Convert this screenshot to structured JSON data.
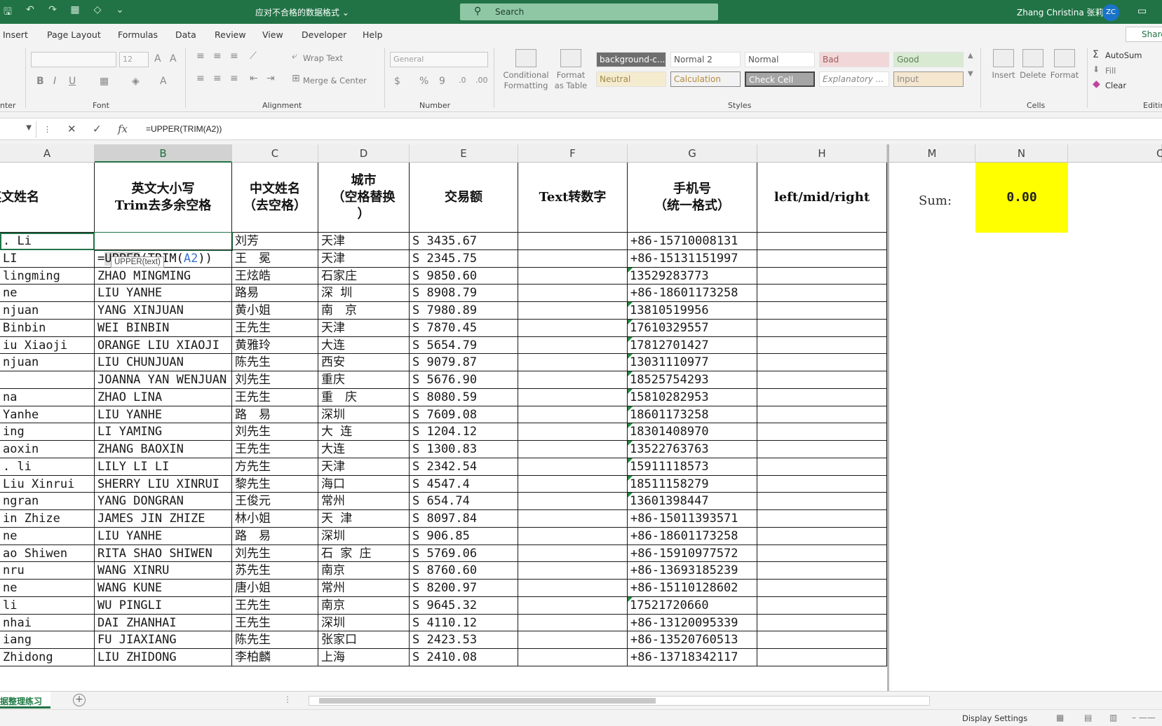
{
  "title_bar": {
    "doc_title": "应对不合格的数据格式",
    "search_placeholder": "Search",
    "user_name": "Zhang Christina 张莉",
    "avatar_initials": "ZC"
  },
  "menu_tabs": [
    "Insert",
    "Page Layout",
    "Formulas",
    "Data",
    "Review",
    "View",
    "Developer",
    "Help"
  ],
  "share_label": "Share",
  "ribbon": {
    "font_size": "12",
    "wrap_text": "Wrap Text",
    "merge_center": "Merge & Center",
    "number_format": "General",
    "conditional_formatting": "Conditional Formatting",
    "format_as_table": "Format as Table",
    "styles": [
      "background-c...",
      "Normal 2",
      "Normal",
      "Bad",
      "Good",
      "Neutral",
      "Calculation",
      "Check Cell",
      "Explanatory ...",
      "Input"
    ],
    "insert": "Insert",
    "delete": "Delete",
    "format": "Format",
    "autosum": "AutoSum",
    "fill": "Fill",
    "clear": "Clear",
    "groups": {
      "font": "Font",
      "alignment": "Alignment",
      "number": "Number",
      "styles": "Styles",
      "cells": "Cells",
      "editing": "Editin",
      "clipboard": "nter"
    }
  },
  "formula_bar": {
    "formula": "=UPPER(TRIM(A2))"
  },
  "columns": [
    "A",
    "B",
    "C",
    "D",
    "E",
    "F",
    "G",
    "H",
    "M",
    "N",
    "O"
  ],
  "header_row": {
    "A": "英文姓名",
    "B": "英文大小写\nTrim去多余空格",
    "C": "中文姓名\n（去空格）",
    "D": "城市\n（空格替换\n）",
    "E": "交易额",
    "F": "Text转数字",
    "G": "手机号\n（统一格式）",
    "H": "left/mid/right",
    "M": "Sum:",
    "N": "0.00"
  },
  "edit_cell": {
    "prefix": "=",
    "fn_highlight": "UPPER",
    "mid": "(TRIM(",
    "ref": "A2",
    "suffix": "))",
    "tooltip": "UPPER(text)"
  },
  "rows": [
    {
      "a": ". Li",
      "b": "",
      "c": "刘芳",
      "d": "天津",
      "e": "S 3435.67",
      "g": "+86-15710008131",
      "tri": false
    },
    {
      "a": "LI",
      "b": "",
      "c": "王　冕",
      "d": "天津",
      "e": "S 2345.75",
      "g": "+86-15131151997",
      "tri": false
    },
    {
      "a": "lingming",
      "b": "ZHAO MINGMING",
      "c": "王炫皓",
      "d": "石家庄",
      "e": "S 9850.60",
      "g": "13529283773",
      "tri": true
    },
    {
      "a": "ne",
      "b": "LIU YANHE",
      "c": "路易",
      "d": "深 圳",
      "e": "S 8908.79",
      "g": "+86-18601173258",
      "tri": false
    },
    {
      "a": "njuan",
      "b": "YANG XINJUAN",
      "c": "黄小姐",
      "d": "南　京",
      "e": "S 7980.89",
      "g": "13810519956",
      "tri": true
    },
    {
      "a": "  Binbin",
      "b": "WEI BINBIN",
      "c": "王先生",
      "d": "天津",
      "e": "S 7870.45",
      "g": "17610329557",
      "tri": true
    },
    {
      "a": "iu Xiaoji",
      "b": "ORANGE LIU XIAOJI",
      "c": "黄雅玲",
      "d": "大连",
      "e": "S 5654.79",
      "g": "17812701427",
      "tri": true
    },
    {
      "a": "njuan",
      "b": "LIU CHUNJUAN",
      "c": "陈先生",
      "d": "西安",
      "e": "S 9079.87",
      "g": "13031110977",
      "tri": true
    },
    {
      "a": "",
      "b": "JOANNA YAN WENJUAN",
      "c": "刘先生",
      "d": "重庆",
      "e": "S 5676.90",
      "g": "18525754293",
      "tri": true
    },
    {
      "a": "na",
      "b": "ZHAO LINA",
      "c": "王先生",
      "d": "重　庆",
      "e": "S 8080.59",
      "g": "15810282953",
      "tri": true
    },
    {
      "a": "Yanhe",
      "b": "LIU YANHE",
      "c": "路　易",
      "d": "深圳",
      "e": "S 7609.08",
      "g": "18601173258",
      "tri": true
    },
    {
      "a": "ing",
      "b": "LI YAMING",
      "c": "刘先生",
      "d": "大 连",
      "e": "S 1204.12",
      "g": "18301408970",
      "tri": true
    },
    {
      "a": "aoxin",
      "b": "ZHANG BAOXIN",
      "c": "王先生",
      "d": "大连",
      "e": "S 1300.83",
      "g": "13522763763",
      "tri": true
    },
    {
      "a": ". li",
      "b": "LILY LI LI",
      "c": "方先生",
      "d": "天津",
      "e": "S 2342.54",
      "g": "15911118573",
      "tri": true
    },
    {
      "a": "  Liu Xinrui",
      "b": "SHERRY LIU XINRUI",
      "c": "黎先生",
      "d": "海口",
      "e": "S 4547.4",
      "g": "18511158279",
      "tri": true
    },
    {
      "a": "ngran",
      "b": "YANG DONGRAN",
      "c": "王俊元",
      "d": "常州",
      "e": "S 654.74",
      "g": "13601398447",
      "tri": true
    },
    {
      "a": "in    Zhize",
      "b": "JAMES JIN ZHIZE",
      "c": "林小姐",
      "d": "天 津",
      "e": "S 8097.84",
      "g": "+86-15011393571",
      "tri": false
    },
    {
      "a": "ne",
      "b": "LIU YANHE",
      "c": "路　易",
      "d": "深圳",
      "e": "S 906.85",
      "g": "+86-18601173258",
      "tri": false
    },
    {
      "a": "ao  Shiwen",
      "b": "RITA SHAO SHIWEN",
      "c": "刘先生",
      "d": "石 家 庄",
      "e": "S 5769.06",
      "g": "+86-15910977572",
      "tri": false
    },
    {
      "a": "nru",
      "b": "WANG XINRU",
      "c": "苏先生",
      "d": "南京",
      "e": "S 8760.60",
      "g": "+86-13693185239",
      "tri": false
    },
    {
      "a": "ne",
      "b": "WANG KUNE",
      "c": "唐小姐",
      "d": "常州",
      "e": "S 8200.97",
      "g": "+86-15110128602",
      "tri": false
    },
    {
      "a": "li",
      "b": "WU PINGLI",
      "c": "王先生",
      "d": "南京",
      "e": "S 9645.32",
      "g": "17521720660",
      "tri": true
    },
    {
      "a": "nhai",
      "b": "DAI ZHANHAI",
      "c": "王先生",
      "d": "深圳",
      "e": "S 4110.12",
      "g": "+86-13120095339",
      "tri": false
    },
    {
      "a": "iang",
      "b": "FU JIAXIANG",
      "c": "陈先生",
      "d": "张家口",
      "e": "S 2423.53",
      "g": "+86-13520760513",
      "tri": false
    },
    {
      "a": "Zhidong",
      "b": "LIU ZHIDONG",
      "c": "李柏麟",
      "d": "上海",
      "e": "S 2410.08",
      "g": "+86-13718342117",
      "tri": false
    }
  ],
  "sheet_tab": "据整理练习",
  "status": {
    "display_settings": "Display Settings"
  }
}
